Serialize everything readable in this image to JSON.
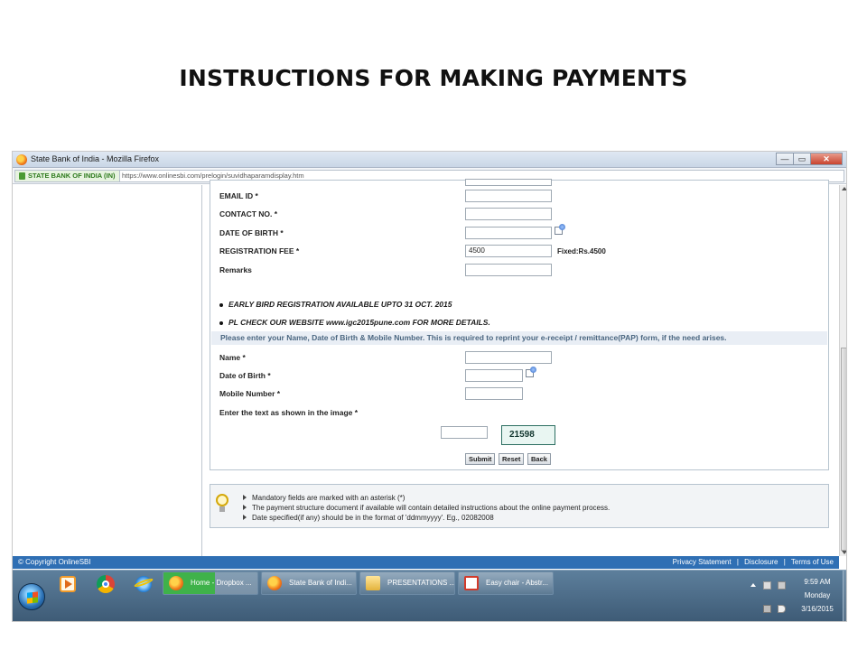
{
  "slide": {
    "title": "INSTRUCTIONS FOR MAKING PAYMENTS"
  },
  "browser": {
    "window_title": "State Bank of India - Mozilla Firefox",
    "window_buttons": {
      "minimize": "—",
      "restore": "▭",
      "close": "✕"
    },
    "site_identity": "STATE BANK OF INDIA (IN)",
    "url": "https://www.onlinesbi.com/prelogin/suvidhaparamdisplay.htm"
  },
  "form": {
    "fields": [
      {
        "label": "EMAIL ID *",
        "value": ""
      },
      {
        "label": "CONTACT NO. *",
        "value": ""
      },
      {
        "label": "DATE OF BIRTH *",
        "value": ""
      },
      {
        "label": "REGISTRATION FEE *",
        "value": "4500",
        "note": "Fixed:Rs.4500"
      },
      {
        "label": "Remarks",
        "value": ""
      }
    ],
    "bullets": [
      "EARLY BIRD REGISTRATION AVAILABLE UPTO 31 OCT. 2015",
      "PL CHECK OUR WEBSITE www.igc2015pune.com FOR MORE DETAILS."
    ],
    "reprint_note": "Please enter your Name, Date of Birth & Mobile Number. This is required to reprint your e-receipt / remittance(PAP) form, if the need arises.",
    "reprint_fields": [
      {
        "label": "Name *",
        "value": ""
      },
      {
        "label": "Date of Birth *",
        "value": ""
      },
      {
        "label": "Mobile Number *",
        "value": ""
      }
    ],
    "captcha": {
      "label": "Enter the text as shown in the image *",
      "value": "",
      "image_text": "21598"
    },
    "buttons": {
      "submit": "Submit",
      "reset": "Reset",
      "back": "Back"
    }
  },
  "info": {
    "lines": [
      "Mandatory fields are marked with an asterisk (*)",
      "The payment structure document if available will contain detailed instructions about the online payment process.",
      "Date specified(if any) should be in the format of 'ddmmyyyy'. Eg., 02082008"
    ]
  },
  "footer": {
    "copyright": "© Copyright OnlineSBI",
    "links": [
      "Privacy Statement",
      "Disclosure",
      "Terms of Use"
    ],
    "separator": "|"
  },
  "taskbar": {
    "tasks": [
      {
        "label": "Home - Dropbox ...",
        "icon": "firefox-icon"
      },
      {
        "label": "State Bank of Indi...",
        "icon": "firefox-icon"
      },
      {
        "label": "PRESENTATIONS ...",
        "icon": "folder-icon"
      },
      {
        "label": "Easy chair - Abstr...",
        "icon": "pdf-icon"
      }
    ],
    "clock": {
      "time": "9:59 AM",
      "day": "Monday",
      "date": "3/16/2015"
    }
  }
}
